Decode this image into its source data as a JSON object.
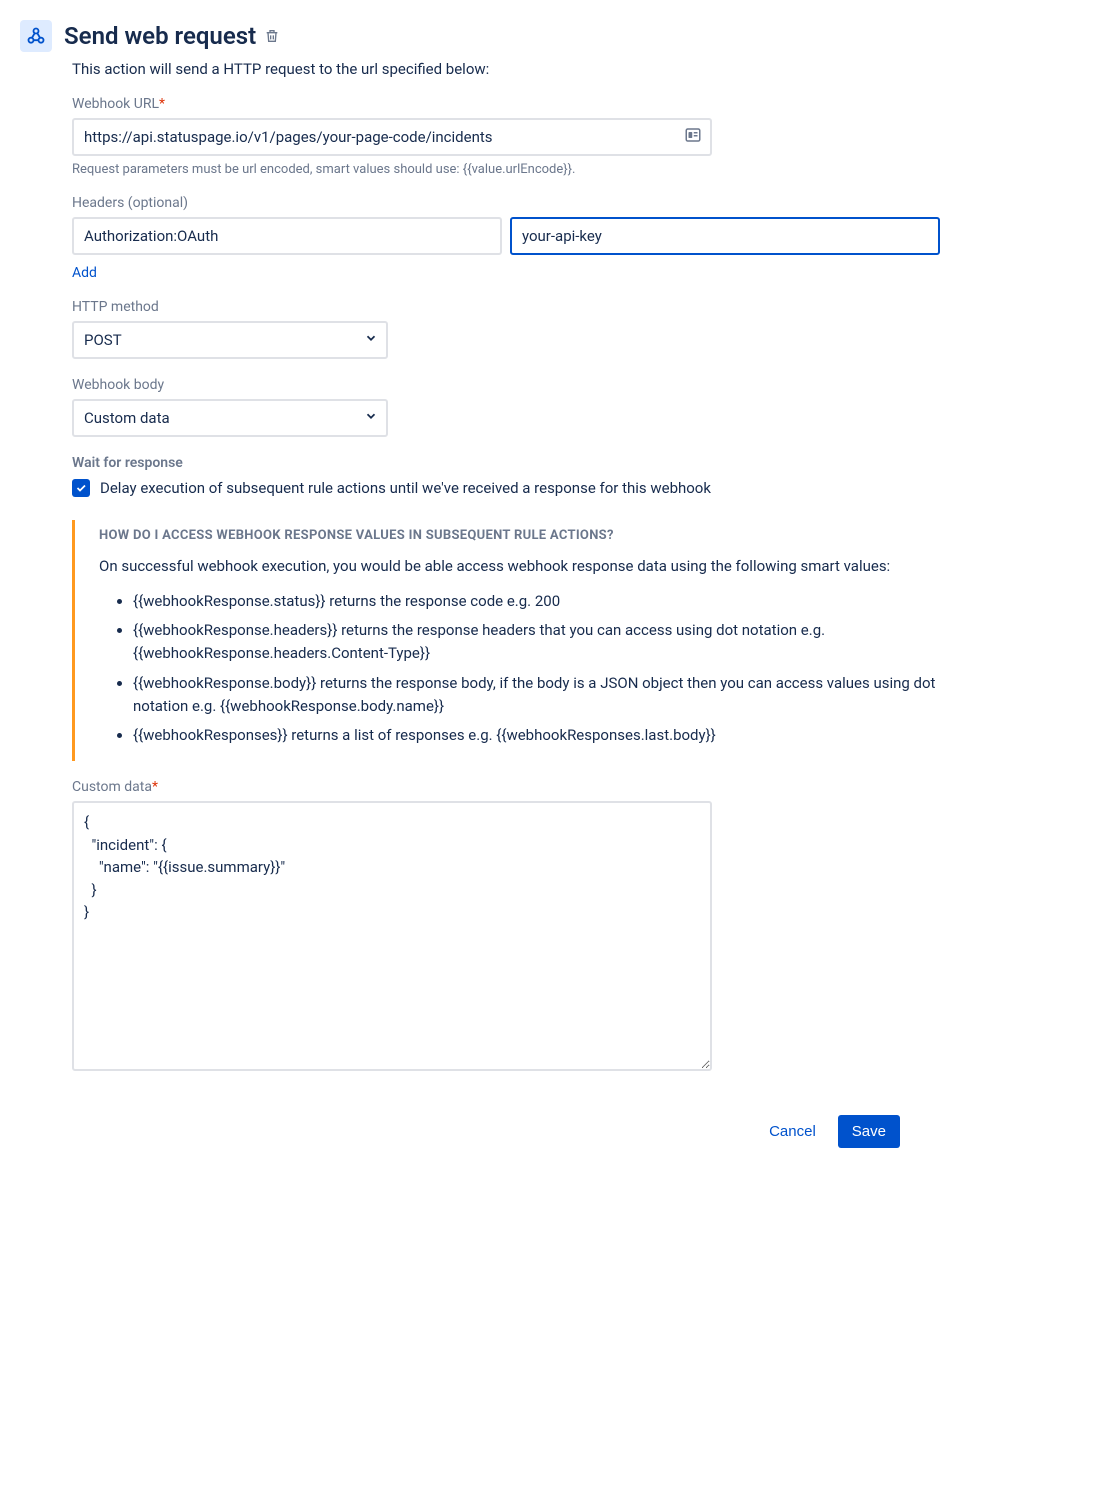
{
  "title": "Send web request",
  "description": "This action will send a HTTP request to the url specified below:",
  "webhook_url": {
    "label": "Webhook URL",
    "value": "https://api.statuspage.io/v1/pages/your-page-code/incidents",
    "hint": "Request parameters must be url encoded, smart values should use: {{value.urlEncode}}."
  },
  "headers": {
    "label": "Headers (optional)",
    "key": "Authorization:OAuth",
    "value": "your-api-key",
    "add_label": "Add"
  },
  "http_method": {
    "label": "HTTP method",
    "value": "POST"
  },
  "webhook_body": {
    "label": "Webhook body",
    "value": "Custom data"
  },
  "wait": {
    "label": "Wait for response",
    "checkbox_label": "Delay execution of subsequent rule actions until we've received a response for this webhook",
    "checked": true
  },
  "info": {
    "title": "HOW DO I ACCESS WEBHOOK RESPONSE VALUES IN SUBSEQUENT RULE ACTIONS?",
    "intro": "On successful webhook execution, you would be able access webhook response data using the following smart values:",
    "items": [
      "{{webhookResponse.status}} returns the response code e.g. 200",
      "{{webhookResponse.headers}} returns the response headers that you can access using dot notation e.g. {{webhookResponse.headers.Content-Type}}",
      "{{webhookResponse.body}} returns the response body, if the body is a JSON object then you can access values using dot notation e.g. {{webhookResponse.body.name}}",
      "{{webhookResponses}} returns a list of responses e.g. {{webhookResponses.last.body}}"
    ]
  },
  "custom_data": {
    "label": "Custom data",
    "value": "{\n  \"incident\": {\n    \"name\": \"{{issue.summary}}\"\n  }\n}"
  },
  "actions": {
    "cancel": "Cancel",
    "save": "Save"
  }
}
